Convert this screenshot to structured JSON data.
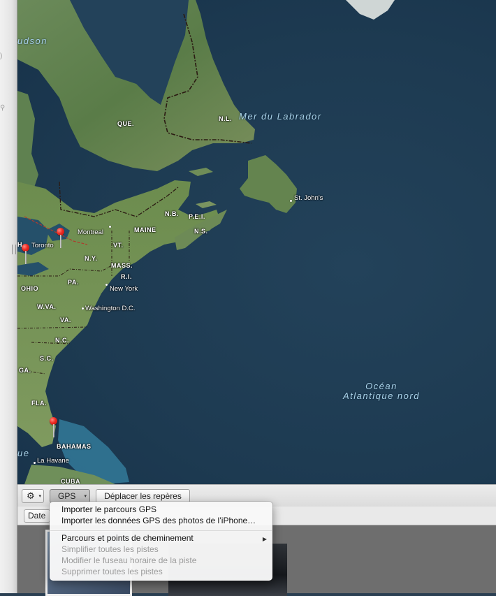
{
  "map": {
    "labels": {
      "hudson": "udson",
      "quebec": "QUE.",
      "newfoundland": "N.L.",
      "labrador_sea": "Mer du Labrador",
      "st_johns": "St. John's",
      "new_brunswick": "N.B.",
      "pei": "P.E.I.",
      "nova_scotia": "N.S.",
      "maine": "MAINE",
      "montreal": "Montreal",
      "toronto": "Toronto",
      "vermont": "VT.",
      "new_york_state": "N.Y.",
      "massachusetts": "MASS.",
      "rhode_island": "R.I.",
      "pennsylvania": "PA.",
      "new_york_city": "New York",
      "ohio": "OHIO",
      "west_virginia": "W.VA.",
      "washington": "Washington D.C.",
      "virginia": "VA.",
      "north_carolina": "N.C.",
      "south_carolina": "S.C.",
      "georgia": "GA.",
      "florida": "FLA.",
      "bahamas": "BAHAMAS",
      "havana": "La Havane",
      "cuba": "CUBA",
      "ocean_line1": "Océan",
      "ocean_line2": "Atlantique nord",
      "edge_h": "H",
      "edge_ue": "ue"
    },
    "pins": [
      "toronto-pin",
      "montreal-pin",
      "florida-pin"
    ]
  },
  "toolbar": {
    "action_icon": "gear-icon",
    "gps_label": "GPS",
    "move_pins_label": "Déplacer les repères"
  },
  "filter": {
    "date_label": "Date"
  },
  "gps_menu": {
    "items": [
      {
        "label": "Importer le parcours GPS",
        "enabled": true
      },
      {
        "label": "Importer les données GPS des photos de l’iPhone…",
        "enabled": true
      },
      {
        "label": "Parcours et points de cheminement",
        "enabled": true,
        "submenu": true
      },
      {
        "label": "Simplifier toutes les pistes",
        "enabled": false
      },
      {
        "label": "Modifier le fuseau horaire de la piste",
        "enabled": false
      },
      {
        "label": "Supprimer toutes les pistes",
        "enabled": false
      }
    ]
  },
  "colors": {
    "ocean": "#1d3a51",
    "land": "#5d7e4c",
    "pin": "#ee2a22",
    "menu_bg": "#f8f8f8",
    "disabled_text": "#9b9b9b"
  }
}
